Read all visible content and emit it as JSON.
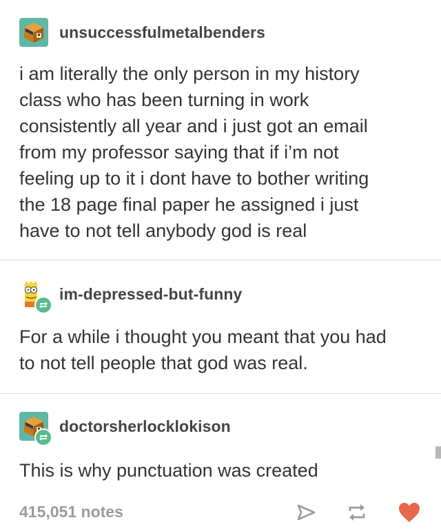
{
  "posts": [
    {
      "username": "unsuccessfulmetalbenders",
      "avatar_icon": "cube-avatar-icon",
      "lines": [
        "i am literally the only person in my history",
        "class who has been turning in work",
        "consistently all year and i just got an email",
        "from my professor saying that if i’m not",
        "feeling up to it i dont have to bother writing",
        "the 18 page final paper he assigned i just",
        "have to not tell anybody god is real"
      ]
    },
    {
      "username": "im-depressed-but-funny",
      "avatar_icon": "cartoon-character-avatar-icon",
      "lines": [
        "For a while i thought you meant that you had",
        "to not tell people that god was real."
      ]
    },
    {
      "username": "doctorsherlocklokison",
      "avatar_icon": "cube-avatar-icon",
      "lines": [
        "This is why punctuation was created"
      ]
    }
  ],
  "footer": {
    "notes": "415,051 notes",
    "share_icon": "paper-plane-icon",
    "reblog_icon": "reblog-icon",
    "like_icon": "heart-icon"
  },
  "colors": {
    "reblog_green": "#56bc8a",
    "heart_red": "#e8674a",
    "avatar_teal": "#5fb7a5",
    "notes_gray": "#9a9a9a"
  }
}
